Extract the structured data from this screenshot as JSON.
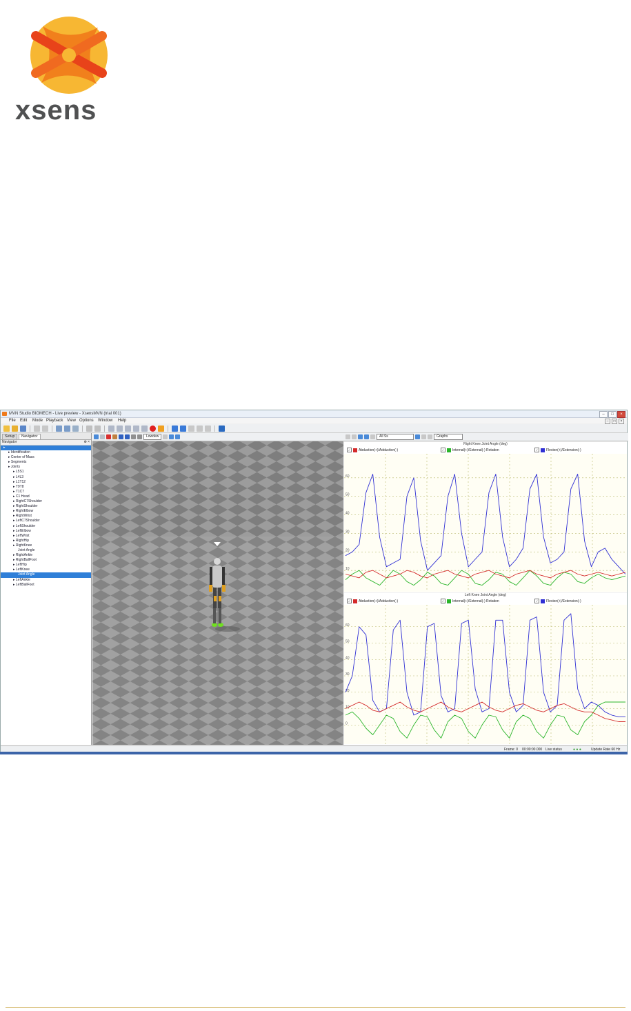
{
  "logo": {
    "text": "xsens",
    "mark_colors": [
      "#f7b733",
      "#ef6a1b",
      "#e8431a"
    ]
  },
  "window": {
    "title": "MVN Studio BIOMECH - Live preview - XsensMVN (trial 001)",
    "buttons": [
      "–",
      "□",
      "×"
    ]
  },
  "menu": [
    "File",
    "Edit",
    "Mode",
    "Playback",
    "View",
    "Options",
    "Window",
    "Help"
  ],
  "side_tabs": [
    "Setup",
    "Navigator"
  ],
  "navigator_header": "Navigator",
  "tree": [
    {
      "label": "",
      "depth": 0,
      "selected": true
    },
    {
      "label": "Identification",
      "depth": 1
    },
    {
      "label": "Center of Mass",
      "depth": 1
    },
    {
      "label": "Segments",
      "depth": 1
    },
    {
      "label": "Joints",
      "depth": 1
    },
    {
      "label": "L5S1",
      "depth": 2
    },
    {
      "label": "L4L3",
      "depth": 2
    },
    {
      "label": "L1T12",
      "depth": 2
    },
    {
      "label": "T9T8",
      "depth": 2
    },
    {
      "label": "T1C7",
      "depth": 2
    },
    {
      "label": "C1 Head",
      "depth": 2
    },
    {
      "label": "RightC7Shoulder",
      "depth": 2
    },
    {
      "label": "RightShoulder",
      "depth": 2
    },
    {
      "label": "RightElbow",
      "depth": 2
    },
    {
      "label": "RightWrist",
      "depth": 2
    },
    {
      "label": "LeftC7Shoulder",
      "depth": 2
    },
    {
      "label": "LeftShoulder",
      "depth": 2
    },
    {
      "label": "LeftElbow",
      "depth": 2
    },
    {
      "label": "LeftWrist",
      "depth": 2
    },
    {
      "label": "RightHip",
      "depth": 2
    },
    {
      "label": "RightKnee",
      "depth": 2
    },
    {
      "label": "Joint Angle",
      "depth": 3
    },
    {
      "label": "RightAnkle",
      "depth": 2
    },
    {
      "label": "RightBallFoot",
      "depth": 2
    },
    {
      "label": "LeftHip",
      "depth": 2
    },
    {
      "label": "LeftKnee",
      "depth": 2
    },
    {
      "label": "Joint Angle",
      "depth": 3,
      "selected": true
    },
    {
      "label": "LeftAnkle",
      "depth": 2
    },
    {
      "label": "LeftBallFoot",
      "depth": 2
    }
  ],
  "viewport": {
    "camera_select": "Lowdew"
  },
  "graphs_toolbar": {
    "range_select": "All Ss",
    "layout_select": "Graphs"
  },
  "legend_labels": [
    "Abduction(+)/Adduction(-)",
    "Internal(+)/External(-) Rotation",
    "Flexion(+)/Extension(-)"
  ],
  "colors": {
    "red": "#d42a2a",
    "green": "#2ab52a",
    "blue": "#2f2fd4",
    "selection": "#2f7fd8"
  },
  "chart_data": [
    {
      "type": "line",
      "title": "Right Knee Joint Angle (deg)",
      "yticks": [
        "60",
        "50",
        "40",
        "30",
        "20",
        "10"
      ],
      "ylim": [
        0,
        70
      ],
      "series": [
        {
          "name": "Flexion(+)/Extension(-)",
          "color": "blue",
          "values": [
            18,
            20,
            24,
            52,
            62,
            28,
            12,
            14,
            16,
            50,
            60,
            26,
            10,
            14,
            18,
            50,
            62,
            30,
            12,
            16,
            20,
            52,
            62,
            28,
            12,
            16,
            22,
            54,
            62,
            28,
            14,
            16,
            20,
            54,
            62,
            26,
            12,
            20,
            22,
            16,
            12,
            8
          ]
        },
        {
          "name": "Internal(+)/External(-) Rotation",
          "color": "green",
          "values": [
            5,
            8,
            10,
            6,
            4,
            2,
            6,
            10,
            8,
            4,
            2,
            5,
            9,
            7,
            3,
            2,
            6,
            10,
            8,
            3,
            2,
            5,
            9,
            8,
            4,
            2,
            6,
            10,
            7,
            3,
            2,
            6,
            9,
            8,
            4,
            3,
            6,
            8,
            6,
            5,
            6,
            7
          ]
        },
        {
          "name": "Abduction(+)/Adduction(-)",
          "color": "red",
          "values": [
            8,
            7,
            6,
            9,
            10,
            8,
            6,
            7,
            8,
            10,
            9,
            7,
            6,
            8,
            9,
            10,
            8,
            7,
            6,
            8,
            9,
            10,
            8,
            7,
            6,
            8,
            9,
            10,
            8,
            7,
            6,
            8,
            9,
            10,
            8,
            7,
            8,
            9,
            8,
            7,
            8,
            9
          ]
        }
      ]
    },
    {
      "type": "line",
      "title": "Left Knee Joint Angle (deg)",
      "yticks": [
        "60",
        "50",
        "40",
        "30",
        "20",
        "10",
        "0"
      ],
      "ylim": [
        -10,
        70
      ],
      "series": [
        {
          "name": "Flexion(+)/Extension(-)",
          "color": "blue",
          "values": [
            20,
            30,
            60,
            55,
            15,
            8,
            10,
            58,
            64,
            20,
            6,
            8,
            60,
            62,
            18,
            8,
            10,
            62,
            64,
            22,
            8,
            10,
            64,
            64,
            20,
            8,
            12,
            64,
            66,
            20,
            8,
            12,
            64,
            68,
            22,
            10,
            14,
            12,
            8,
            6,
            5,
            5
          ]
        },
        {
          "name": "Internal(+)/External(-) Rotation",
          "color": "green",
          "values": [
            6,
            8,
            4,
            -2,
            -6,
            0,
            6,
            4,
            -4,
            -8,
            0,
            6,
            5,
            -3,
            -8,
            2,
            6,
            4,
            -4,
            -8,
            0,
            6,
            5,
            -3,
            -8,
            2,
            6,
            4,
            -4,
            -8,
            0,
            6,
            5,
            -3,
            -6,
            2,
            6,
            12,
            14,
            14,
            14,
            14
          ]
        },
        {
          "name": "Abduction(+)/Adduction(-)",
          "color": "red",
          "values": [
            10,
            12,
            14,
            12,
            9,
            8,
            10,
            12,
            14,
            11,
            9,
            8,
            10,
            12,
            14,
            11,
            9,
            8,
            10,
            12,
            14,
            11,
            9,
            8,
            10,
            12,
            13,
            11,
            9,
            8,
            10,
            12,
            13,
            11,
            9,
            8,
            8,
            6,
            4,
            3,
            2,
            2
          ]
        }
      ]
    }
  ],
  "status": {
    "frame": "Frame: 0",
    "time": "00:00:00.000",
    "mode": "Live status",
    "rate": "Update Rate 60 Hz"
  }
}
